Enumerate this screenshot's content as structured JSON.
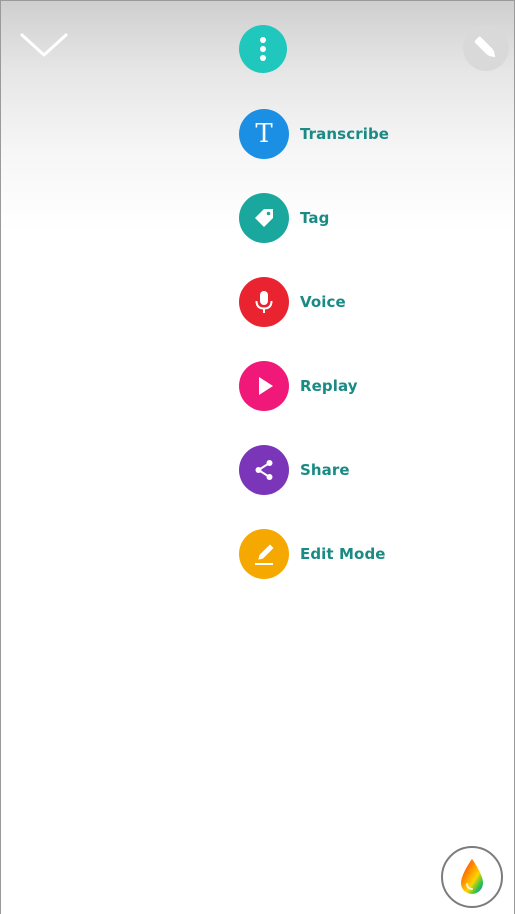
{
  "header": {
    "collapse_icon": "chevron-down-icon",
    "more_icon": "more-vertical-icon",
    "pen_icon": "pen-icon"
  },
  "menu": {
    "items": [
      {
        "label": "Transcribe",
        "icon": "text-t-icon",
        "color": "#1a8fe3"
      },
      {
        "label": "Tag",
        "icon": "tag-icon",
        "color": "#1aa89e"
      },
      {
        "label": "Voice",
        "icon": "microphone-icon",
        "color": "#ea2331"
      },
      {
        "label": "Replay",
        "icon": "play-icon",
        "color": "#f0197a"
      },
      {
        "label": "Share",
        "icon": "share-icon",
        "color": "#7b35b8"
      },
      {
        "label": "Edit Mode",
        "icon": "pencil-icon",
        "color": "#f5a900"
      }
    ],
    "transcribe_glyph": "T"
  },
  "footer": {
    "palette_icon": "color-drop-icon"
  },
  "colors": {
    "accent": "#1fc7bd",
    "label_text": "#1a8a84"
  }
}
